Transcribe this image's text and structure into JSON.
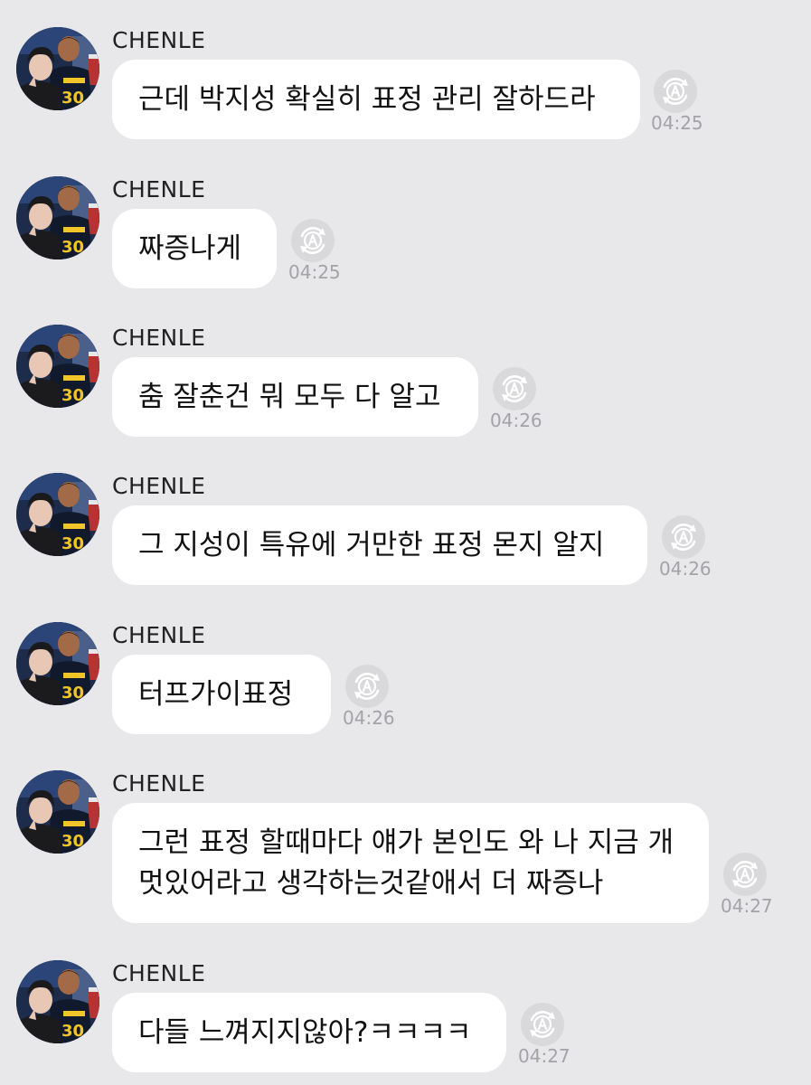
{
  "messages": [
    {
      "sender": "CHENLE",
      "lines": [
        "근데 박지성 확실히 표정 관리 잘하드라"
      ],
      "time": "04:25"
    },
    {
      "sender": "CHENLE",
      "lines": [
        "짜증나게"
      ],
      "time": "04:25"
    },
    {
      "sender": "CHENLE",
      "lines": [
        "춤 잘춘건 뭐 모두 다 알고"
      ],
      "time": "04:26"
    },
    {
      "sender": "CHENLE",
      "lines": [
        "그 지성이 특유에 거만한 표정 몬지 알지"
      ],
      "time": "04:26"
    },
    {
      "sender": "CHENLE",
      "lines": [
        "터프가이표정"
      ],
      "time": "04:26"
    },
    {
      "sender": "CHENLE",
      "lines": [
        "그런 표정 할때마다 얘가 본인도 와 나 지금 개",
        "멋있어라고 생각하는것같애서 더 짜증나"
      ],
      "time": "04:27"
    },
    {
      "sender": "CHENLE",
      "lines": [
        "다들 느껴지지않아?ㅋㅋㅋㅋ"
      ],
      "time": "04:27"
    }
  ],
  "icons": {
    "translate": "translate-icon",
    "avatar": "avatar"
  },
  "colors": {
    "background": "#e8e8ea",
    "bubble": "#ffffff",
    "timestamp": "#a3a3a8"
  }
}
